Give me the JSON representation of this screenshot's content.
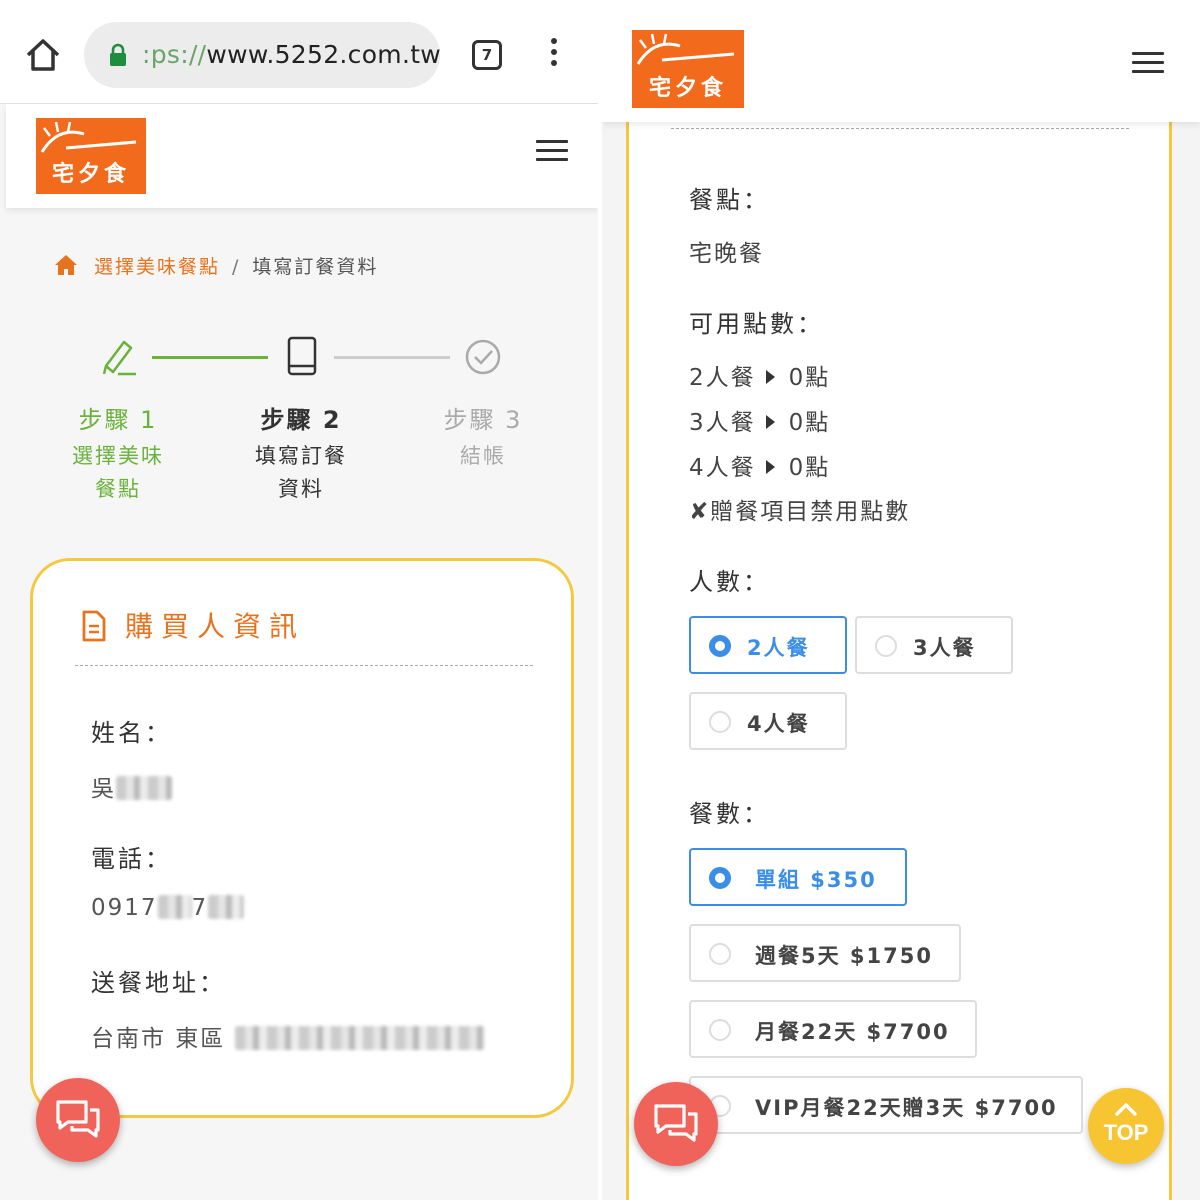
{
  "browser": {
    "url_scheme_visible": ":ps://",
    "url_host": "www.5252.com.tw",
    "tab_count": "7"
  },
  "site": {
    "logo_text": "宅夕食"
  },
  "breadcrumb": {
    "link": "選擇美味餐點",
    "separator": "/",
    "current": "填寫訂餐資料"
  },
  "steps": [
    {
      "label": "步驟 1",
      "desc_line1": "選擇美味",
      "desc_line2": "餐點",
      "state": "done",
      "color": "#6ab23c"
    },
    {
      "label": "步驟 2",
      "desc_line1": "填寫訂餐",
      "desc_line2": "資料",
      "state": "active",
      "color": "#333333"
    },
    {
      "label": "步驟 3",
      "desc_line1": "結帳",
      "desc_line2": "",
      "state": "pending",
      "color": "#aaaaaa"
    }
  ],
  "buyer": {
    "title": "購買人資訊",
    "name_label": "姓名：",
    "name_value": "吳",
    "phone_label": "電話：",
    "phone_prefix": "0917",
    "phone_mid": "7",
    "address_label": "送餐地址：",
    "address_value": "台南市 東區"
  },
  "order": {
    "meal_label": "餐點：",
    "meal_value": "宅晚餐",
    "points_label": "可用點數：",
    "points": [
      {
        "set": "2人餐",
        "value": "0點"
      },
      {
        "set": "3人餐",
        "value": "0點"
      },
      {
        "set": "4人餐",
        "value": "0點"
      }
    ],
    "points_note": "✘贈餐項目禁用點數",
    "people_label": "人數：",
    "people_options": [
      "2人餐",
      "3人餐",
      "4人餐"
    ],
    "people_selected": "2人餐",
    "qty_label": "餐數：",
    "qty_options": [
      "單組 $350",
      "週餐5天 $1750",
      "月餐22天 $7700",
      "VIP月餐22天贈3天 $7700"
    ],
    "qty_selected": "單組 $350"
  },
  "fab": {
    "top_label": "TOP"
  },
  "colors": {
    "brand_orange": "#e8731e",
    "logo_bg": "#f26b1d",
    "card_border": "#f5c842",
    "step_done": "#6ab23c",
    "selected_blue": "#3a8ee6",
    "chat_red": "#f0635a",
    "top_yellow": "#f7c531"
  },
  "icons": [
    "home-icon",
    "lock-icon",
    "tabs-icon",
    "more-vert-icon",
    "menu-icon",
    "pencil-icon",
    "tablet-icon",
    "check-circle-icon",
    "document-icon",
    "chat-icon",
    "chevron-up-icon"
  ]
}
